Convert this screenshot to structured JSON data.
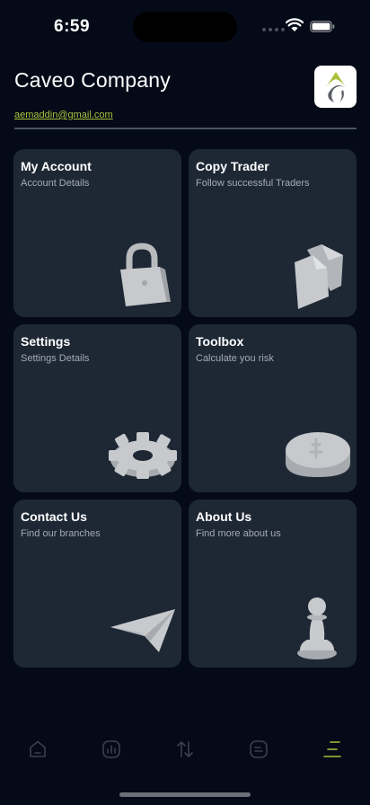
{
  "status_bar": {
    "time": "6:59"
  },
  "header": {
    "company_name": "Caveo Company",
    "email": "aemaddin@gmail.com"
  },
  "cards": [
    {
      "title": "My Account",
      "subtitle": "Account Details",
      "icon": "padlock-icon"
    },
    {
      "title": "Copy Trader",
      "subtitle": "Follow successful Traders",
      "icon": "copy-documents-icon"
    },
    {
      "title": "Settings",
      "subtitle": "Settings Details",
      "icon": "gear-icon"
    },
    {
      "title": "Toolbox",
      "subtitle": "Calculate you risk",
      "icon": "coin-icon"
    },
    {
      "title": "Contact Us",
      "subtitle": "Find our branches",
      "icon": "paper-plane-icon"
    },
    {
      "title": "About Us",
      "subtitle": "Find more about us",
      "icon": "chess-pawn-icon"
    }
  ],
  "bottom_nav": {
    "items": [
      {
        "icon": "home-icon",
        "active": false
      },
      {
        "icon": "bar-chart-icon",
        "active": false
      },
      {
        "icon": "transfer-arrows-icon",
        "active": false
      },
      {
        "icon": "news-icon",
        "active": false
      },
      {
        "icon": "menu-icon",
        "active": true
      }
    ]
  },
  "colors": {
    "background": "#050a18",
    "card": "#1e2835",
    "accent": "#a8c23a",
    "nav_inactive": "#3a414c",
    "illustration": "#c7c9cc"
  }
}
